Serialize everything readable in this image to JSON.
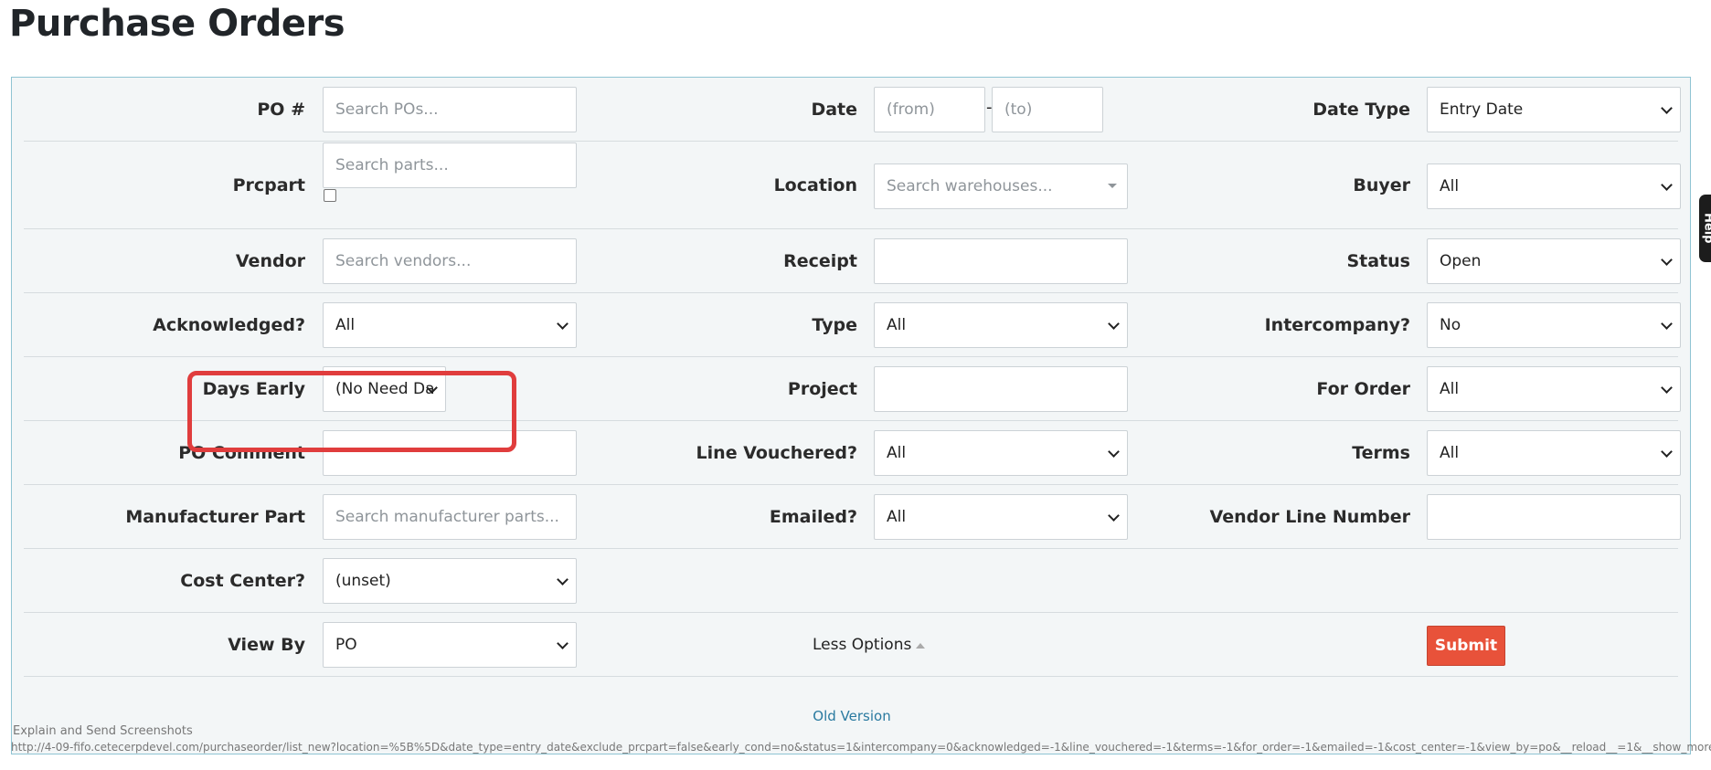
{
  "page": {
    "title": "Purchase Orders"
  },
  "rows": [
    {
      "c1": {
        "label": "PO #",
        "type": "input",
        "placeholder": "Search POs..."
      },
      "c2": {
        "label": "Date",
        "type": "date-range",
        "from_placeholder": "(from)",
        "separator": "-",
        "to_placeholder": "(to)"
      },
      "c3": {
        "label": "Date Type",
        "type": "select",
        "value": "Entry Date"
      }
    },
    {
      "c1": {
        "label": "Prcpart",
        "type": "input",
        "placeholder": "Search parts...",
        "has_checkbox": true
      },
      "c2": {
        "label": "Location",
        "type": "combo",
        "placeholder": "Search warehouses..."
      },
      "c3": {
        "label": "Buyer",
        "type": "select",
        "value": "All"
      }
    },
    {
      "c1": {
        "label": "Vendor",
        "type": "input",
        "placeholder": "Search vendors..."
      },
      "c2": {
        "label": "Receipt",
        "type": "input",
        "value": ""
      },
      "c3": {
        "label": "Status",
        "type": "select",
        "value": "Open"
      }
    },
    {
      "c1": {
        "label": "Acknowledged?",
        "type": "select",
        "value": "All"
      },
      "c2": {
        "label": "Type",
        "type": "select",
        "value": "All"
      },
      "c3": {
        "label": "Intercompany?",
        "type": "select",
        "value": "No"
      }
    },
    {
      "c1": {
        "label": "Days Early",
        "type": "select-small",
        "value": "(No Need Da"
      },
      "c2": {
        "label": "Project",
        "type": "input",
        "value": ""
      },
      "c3": {
        "label": "For Order",
        "type": "select",
        "value": "All"
      }
    },
    {
      "c1": {
        "label": "PO Comment",
        "type": "input",
        "value": ""
      },
      "c2": {
        "label": "Line Vouchered?",
        "type": "select",
        "value": "All"
      },
      "c3": {
        "label": "Terms",
        "type": "select",
        "value": "All"
      }
    },
    {
      "c1": {
        "label": "Manufacturer Part",
        "type": "input",
        "placeholder": "Search manufacturer parts..."
      },
      "c2": {
        "label": "Emailed?",
        "type": "select",
        "value": "All"
      },
      "c3": {
        "label": "Vendor Line Number",
        "type": "input",
        "value": ""
      }
    },
    {
      "c1": {
        "label": "Cost Center?",
        "type": "select",
        "value": "(unset)"
      }
    },
    {
      "c1": {
        "label": "View By",
        "type": "select",
        "value": "PO"
      }
    }
  ],
  "actions": {
    "less_options_label": "Less Options",
    "submit_label": "Submit",
    "old_version_label": "Old Version"
  },
  "status_bar": {
    "caption": "Explain and Send Screenshots",
    "url": "http://4-09-fifo.cetecerpdevel.com/purchaseorder/list_new?location=%5B%5D&date_type=entry_date&exclude_prcpart=false&early_cond=no&status=1&intercompany=0&acknowledged=-1&line_vouchered=-1&terms=-1&for_order=-1&emailed=-1&cost_center=-1&view_by=po&__reload__=1&__show_more"
  },
  "help_tab": {
    "label": "Help"
  },
  "colors": {
    "accent_border": "#8fc4d3",
    "highlight": "#e03d3d",
    "submit": "#e8523a",
    "link": "#2a7aa0"
  }
}
